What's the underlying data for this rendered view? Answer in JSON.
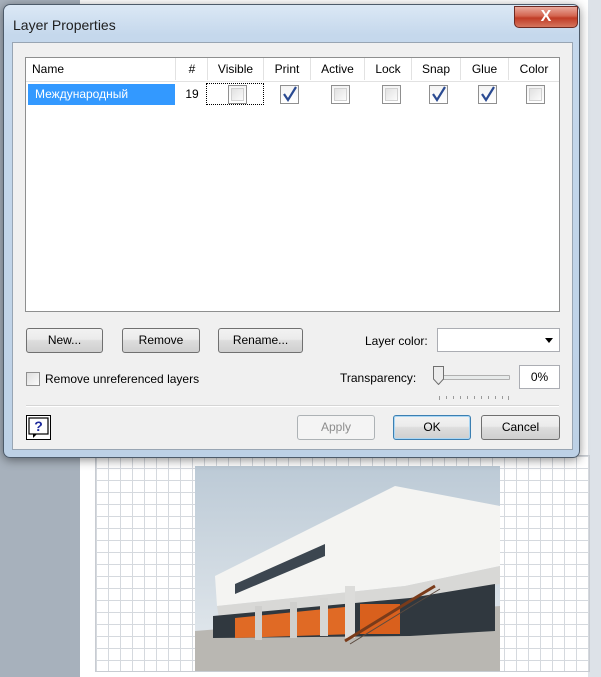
{
  "dialog": {
    "title": "Layer Properties",
    "close_label": "X"
  },
  "table": {
    "columns": [
      "Name",
      "#",
      "Visible",
      "Print",
      "Active",
      "Lock",
      "Snap",
      "Glue",
      "Color"
    ],
    "rows": [
      {
        "name": "Международный",
        "number": "19",
        "visible": false,
        "print": true,
        "active": false,
        "lock": false,
        "snap": true,
        "glue": true,
        "color": false
      }
    ]
  },
  "buttons": {
    "new": "New...",
    "remove": "Remove",
    "rename": "Rename...",
    "apply": "Apply",
    "ok": "OK",
    "cancel": "Cancel"
  },
  "layer_color": {
    "label": "Layer color:",
    "value": ""
  },
  "remove_unreferenced": {
    "label": "Remove unreferenced layers",
    "checked": false
  },
  "transparency": {
    "label": "Transparency:",
    "value": "0%"
  },
  "colors": {
    "selection": "#3399ff",
    "checkmark": "#2a4a91",
    "close_button": "#c74530"
  }
}
